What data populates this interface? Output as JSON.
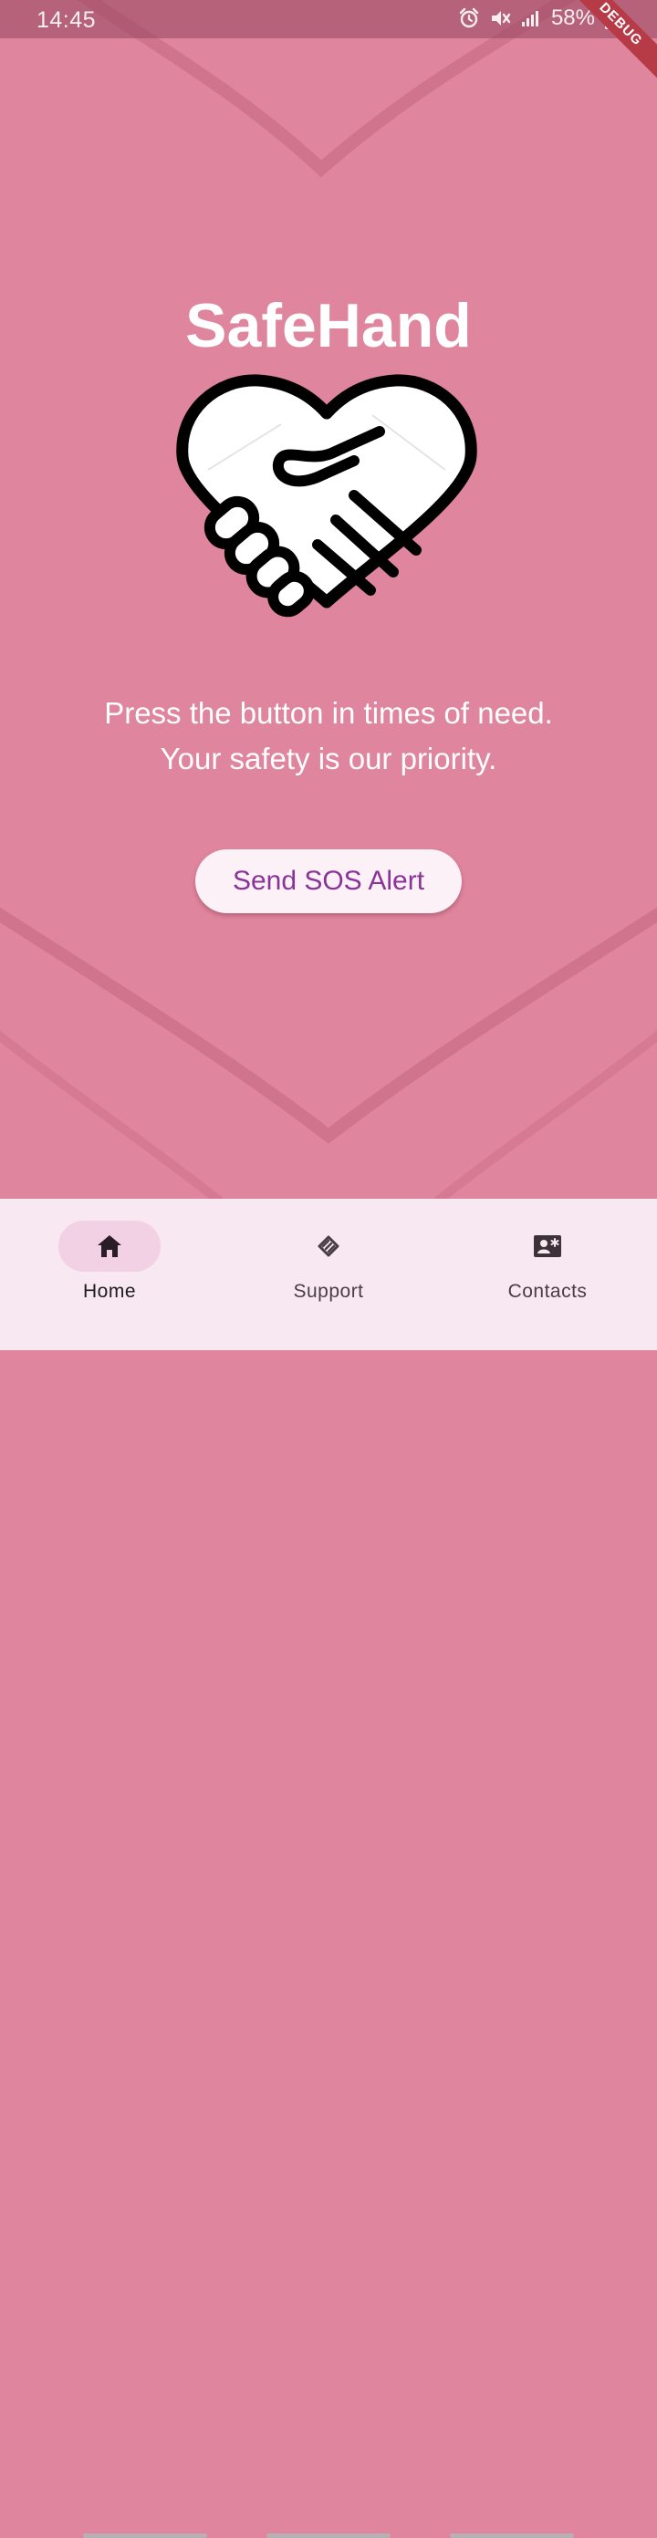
{
  "status_bar": {
    "time": "14:45",
    "battery": "58%",
    "icons": [
      "alarm-icon",
      "mute-icon",
      "signal-icon",
      "battery-icon"
    ]
  },
  "debug_banner": "DEBUG",
  "app": {
    "title": "SafeHand",
    "logo_icon": "heart-handshake-icon",
    "tagline_line1": "Press the button in times of need.",
    "tagline_line2": "Your safety is our priority.",
    "sos_button": "Send SOS Alert"
  },
  "bottom_nav": {
    "items": [
      {
        "label": "Home",
        "icon": "home-icon",
        "active": true
      },
      {
        "label": "Support",
        "icon": "handshake-icon",
        "active": false
      },
      {
        "label": "Contacts",
        "icon": "contact-card-icon",
        "active": false
      }
    ]
  },
  "colors": {
    "background": "#df859d",
    "button_text": "#8a3497",
    "nav_background": "#f7e8f1",
    "active_pill": "#f3d1e4"
  }
}
